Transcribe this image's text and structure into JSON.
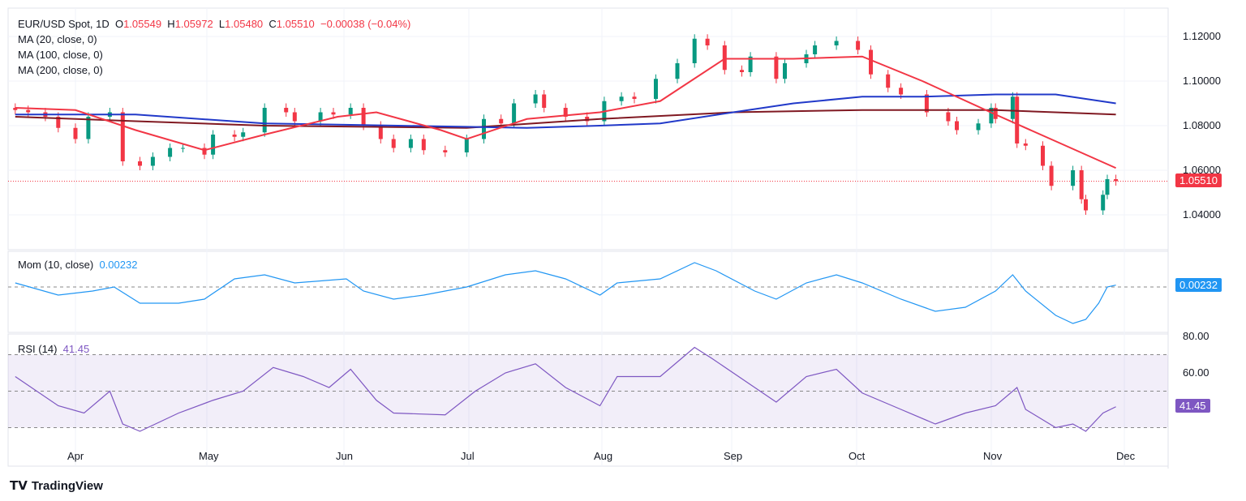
{
  "header": {
    "symbol": "EUR/USD Spot, 1D",
    "o_label": "O",
    "o": "1.05549",
    "h_label": "H",
    "h": "1.05972",
    "l_label": "L",
    "l": "1.05480",
    "c_label": "C",
    "c": "1.05510",
    "change": "−0.00038 (−0.04%)"
  },
  "indicators": {
    "ma20": "MA (20, close, 0)",
    "ma100": "MA (100, close, 0)",
    "ma200": "MA (200, close, 0)",
    "mom": "Mom (10, close)",
    "mom_value": "0.00232",
    "rsi": "RSI (14)",
    "rsi_value": "41.45"
  },
  "brand": "TradingView",
  "colors": {
    "up": "#089981",
    "down": "#f23645",
    "ma20": "#f23645",
    "ma100": "#2139c9",
    "ma200": "#801922",
    "mom": "#2196f3",
    "rsi": "#7e57c2"
  },
  "chart_data": [
    {
      "type": "candlestick",
      "title": "EUR/USD Spot, 1D",
      "last_price": "1.05510",
      "y_ticks": [
        "1.12000",
        "1.10000",
        "1.08000",
        "1.06000",
        "1.04000"
      ],
      "ylim": [
        1.033,
        1.124
      ],
      "x_ticks": [
        "Apr",
        "May",
        "Jun",
        "Jul",
        "Aug",
        "Sep",
        "Oct",
        "Nov",
        "Dec"
      ],
      "closes": [
        [
          "2024-03-18",
          1.087
        ],
        [
          "2024-03-21",
          1.086
        ],
        [
          "2024-03-25",
          1.084
        ],
        [
          "2024-03-28",
          1.079
        ],
        [
          "2024-04-01",
          1.074
        ],
        [
          "2024-04-04",
          1.084
        ],
        [
          "2024-04-09",
          1.086
        ],
        [
          "2024-04-12",
          1.064
        ],
        [
          "2024-04-16",
          1.062
        ],
        [
          "2024-04-19",
          1.066
        ],
        [
          "2024-04-23",
          1.07
        ],
        [
          "2024-04-26",
          1.07
        ],
        [
          "2024-05-01",
          1.067
        ],
        [
          "2024-05-03",
          1.076
        ],
        [
          "2024-05-08",
          1.075
        ],
        [
          "2024-05-10",
          1.077
        ],
        [
          "2024-05-15",
          1.088
        ],
        [
          "2024-05-20",
          1.086
        ],
        [
          "2024-05-22",
          1.082
        ],
        [
          "2024-05-28",
          1.086
        ],
        [
          "2024-05-31",
          1.085
        ],
        [
          "2024-06-04",
          1.088
        ],
        [
          "2024-06-07",
          1.08
        ],
        [
          "2024-06-11",
          1.074
        ],
        [
          "2024-06-14",
          1.07
        ],
        [
          "2024-06-18",
          1.074
        ],
        [
          "2024-06-21",
          1.069
        ],
        [
          "2024-06-26",
          1.068
        ],
        [
          "2024-07-01",
          1.074
        ],
        [
          "2024-07-05",
          1.083
        ],
        [
          "2024-07-09",
          1.081
        ],
        [
          "2024-07-12",
          1.09
        ],
        [
          "2024-07-17",
          1.094
        ],
        [
          "2024-07-19",
          1.088
        ],
        [
          "2024-07-24",
          1.084
        ],
        [
          "2024-07-29",
          1.082
        ],
        [
          "2024-08-02",
          1.091
        ],
        [
          "2024-08-06",
          1.093
        ],
        [
          "2024-08-09",
          1.092
        ],
        [
          "2024-08-14",
          1.101
        ],
        [
          "2024-08-19",
          1.108
        ],
        [
          "2024-08-23",
          1.119
        ],
        [
          "2024-08-26",
          1.116
        ],
        [
          "2024-08-30",
          1.105
        ],
        [
          "2024-09-03",
          1.104
        ],
        [
          "2024-09-05",
          1.111
        ],
        [
          "2024-09-11",
          1.101
        ],
        [
          "2024-09-13",
          1.108
        ],
        [
          "2024-09-18",
          1.112
        ],
        [
          "2024-09-20",
          1.116
        ],
        [
          "2024-09-25",
          1.118
        ],
        [
          "2024-09-30",
          1.114
        ],
        [
          "2024-10-03",
          1.103
        ],
        [
          "2024-10-07",
          1.097
        ],
        [
          "2024-10-10",
          1.094
        ],
        [
          "2024-10-16",
          1.086
        ],
        [
          "2024-10-21",
          1.082
        ],
        [
          "2024-10-23",
          1.078
        ],
        [
          "2024-10-28",
          1.081
        ],
        [
          "2024-10-31",
          1.088
        ],
        [
          "2024-11-01",
          1.083
        ],
        [
          "2024-11-05",
          1.093
        ],
        [
          "2024-11-06",
          1.072
        ],
        [
          "2024-11-08",
          1.071
        ],
        [
          "2024-11-12",
          1.062
        ],
        [
          "2024-11-14",
          1.053
        ],
        [
          "2024-11-19",
          1.06
        ],
        [
          "2024-11-21",
          1.047
        ],
        [
          "2024-11-22",
          1.042
        ],
        [
          "2024-11-26",
          1.049
        ],
        [
          "2024-11-27",
          1.056
        ],
        [
          "2024-11-29",
          1.0551
        ]
      ],
      "ma20": [
        [
          "2024-03-18",
          1.088
        ],
        [
          "2024-04-01",
          1.087
        ],
        [
          "2024-04-15",
          1.078
        ],
        [
          "2024-05-01",
          1.069
        ],
        [
          "2024-05-15",
          1.076
        ],
        [
          "2024-06-01",
          1.084
        ],
        [
          "2024-06-10",
          1.086
        ],
        [
          "2024-06-25",
          1.078
        ],
        [
          "2024-07-01",
          1.074
        ],
        [
          "2024-07-15",
          1.083
        ],
        [
          "2024-08-01",
          1.086
        ],
        [
          "2024-08-15",
          1.091
        ],
        [
          "2024-08-30",
          1.11
        ],
        [
          "2024-09-15",
          1.11
        ],
        [
          "2024-10-01",
          1.111
        ],
        [
          "2024-10-15",
          1.1
        ],
        [
          "2024-11-01",
          1.085
        ],
        [
          "2024-11-15",
          1.073
        ],
        [
          "2024-11-29",
          1.061
        ]
      ],
      "ma100": [
        [
          "2024-03-18",
          1.085
        ],
        [
          "2024-04-15",
          1.085
        ],
        [
          "2024-05-15",
          1.081
        ],
        [
          "2024-06-15",
          1.08
        ],
        [
          "2024-07-15",
          1.079
        ],
        [
          "2024-08-01",
          1.08
        ],
        [
          "2024-08-15",
          1.081
        ],
        [
          "2024-09-01",
          1.086
        ],
        [
          "2024-09-15",
          1.09
        ],
        [
          "2024-10-01",
          1.093
        ],
        [
          "2024-10-15",
          1.093
        ],
        [
          "2024-11-01",
          1.094
        ],
        [
          "2024-11-15",
          1.094
        ],
        [
          "2024-11-29",
          1.09
        ]
      ],
      "ma200": [
        [
          "2024-03-18",
          1.084
        ],
        [
          "2024-04-15",
          1.082
        ],
        [
          "2024-05-15",
          1.08
        ],
        [
          "2024-07-01",
          1.079
        ],
        [
          "2024-08-01",
          1.083
        ],
        [
          "2024-09-01",
          1.086
        ],
        [
          "2024-10-01",
          1.087
        ],
        [
          "2024-11-01",
          1.087
        ],
        [
          "2024-11-29",
          1.085
        ]
      ]
    },
    {
      "type": "line",
      "title": "Mom (10, close)",
      "ylim": [
        -0.05,
        0.04
      ],
      "zero_line": 0,
      "values": [
        [
          "2024-03-18",
          0.005
        ],
        [
          "2024-03-28",
          -0.01
        ],
        [
          "2024-04-05",
          -0.005
        ],
        [
          "2024-04-10",
          0.0
        ],
        [
          "2024-04-16",
          -0.02
        ],
        [
          "2024-04-25",
          -0.02
        ],
        [
          "2024-05-01",
          -0.015
        ],
        [
          "2024-05-08",
          0.01
        ],
        [
          "2024-05-15",
          0.015
        ],
        [
          "2024-05-22",
          0.005
        ],
        [
          "2024-06-03",
          0.01
        ],
        [
          "2024-06-07",
          -0.005
        ],
        [
          "2024-06-14",
          -0.015
        ],
        [
          "2024-06-21",
          -0.01
        ],
        [
          "2024-07-01",
          0.0
        ],
        [
          "2024-07-10",
          0.015
        ],
        [
          "2024-07-17",
          0.02
        ],
        [
          "2024-07-24",
          0.01
        ],
        [
          "2024-08-01",
          -0.01
        ],
        [
          "2024-08-05",
          0.005
        ],
        [
          "2024-08-15",
          0.01
        ],
        [
          "2024-08-23",
          0.03
        ],
        [
          "2024-08-28",
          0.02
        ],
        [
          "2024-09-06",
          -0.005
        ],
        [
          "2024-09-11",
          -0.015
        ],
        [
          "2024-09-18",
          0.005
        ],
        [
          "2024-09-25",
          0.015
        ],
        [
          "2024-10-01",
          0.005
        ],
        [
          "2024-10-10",
          -0.015
        ],
        [
          "2024-10-18",
          -0.03
        ],
        [
          "2024-10-25",
          -0.025
        ],
        [
          "2024-11-01",
          -0.005
        ],
        [
          "2024-11-05",
          0.015
        ],
        [
          "2024-11-08",
          -0.005
        ],
        [
          "2024-11-15",
          -0.035
        ],
        [
          "2024-11-19",
          -0.045
        ],
        [
          "2024-11-22",
          -0.04
        ],
        [
          "2024-11-25",
          -0.02
        ],
        [
          "2024-11-27",
          0.0
        ],
        [
          "2024-11-29",
          0.00232
        ]
      ]
    },
    {
      "type": "line",
      "title": "RSI (14)",
      "ylim": [
        20,
        80
      ],
      "y_ticks": [
        "80.00",
        "60.00"
      ],
      "bands": [
        30,
        50,
        70
      ],
      "values": [
        [
          "2024-03-18",
          58
        ],
        [
          "2024-03-28",
          42
        ],
        [
          "2024-04-03",
          38
        ],
        [
          "2024-04-09",
          50
        ],
        [
          "2024-04-12",
          32
        ],
        [
          "2024-04-16",
          28
        ],
        [
          "2024-04-25",
          38
        ],
        [
          "2024-05-03",
          45
        ],
        [
          "2024-05-10",
          50
        ],
        [
          "2024-05-17",
          63
        ],
        [
          "2024-05-24",
          58
        ],
        [
          "2024-05-30",
          52
        ],
        [
          "2024-06-04",
          62
        ],
        [
          "2024-06-10",
          45
        ],
        [
          "2024-06-14",
          38
        ],
        [
          "2024-06-26",
          37
        ],
        [
          "2024-07-03",
          50
        ],
        [
          "2024-07-10",
          60
        ],
        [
          "2024-07-17",
          65
        ],
        [
          "2024-07-24",
          52
        ],
        [
          "2024-08-01",
          42
        ],
        [
          "2024-08-05",
          58
        ],
        [
          "2024-08-15",
          58
        ],
        [
          "2024-08-23",
          74
        ],
        [
          "2024-08-27",
          68
        ],
        [
          "2024-09-06",
          52
        ],
        [
          "2024-09-11",
          44
        ],
        [
          "2024-09-18",
          58
        ],
        [
          "2024-09-25",
          62
        ],
        [
          "2024-10-01",
          49
        ],
        [
          "2024-10-10",
          40
        ],
        [
          "2024-10-18",
          32
        ],
        [
          "2024-10-25",
          38
        ],
        [
          "2024-11-01",
          42
        ],
        [
          "2024-11-06",
          52
        ],
        [
          "2024-11-08",
          40
        ],
        [
          "2024-11-15",
          30
        ],
        [
          "2024-11-19",
          32
        ],
        [
          "2024-11-22",
          28
        ],
        [
          "2024-11-26",
          38
        ],
        [
          "2024-11-29",
          41.45
        ]
      ]
    }
  ]
}
